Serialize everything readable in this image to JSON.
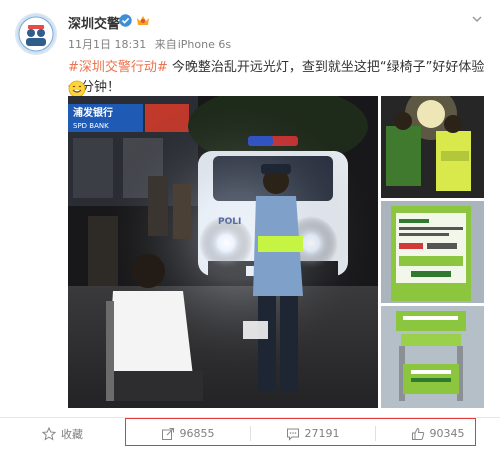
{
  "post": {
    "author": "深圳交警",
    "date": "11月1日 18:31",
    "source_prefix": "来自",
    "source": "iPhone 6s",
    "hashtag": "#深圳交警行动#",
    "text": " 今晚整治乱开远光灯，查到就坐这把“绿椅子”好好体验一分钟！"
  },
  "photos": {
    "bank_sign": "浦发银行",
    "bank_sign_en": "SPD BANK",
    "police_label": "POLI"
  },
  "actions": {
    "favorite_label": "收藏",
    "repost_count": "96855",
    "comment_count": "27191",
    "like_count": "90345"
  },
  "colors": {
    "hashtag": "#eb7350",
    "highlight": "#e03a3a",
    "chair_green": "#8cc63f"
  }
}
